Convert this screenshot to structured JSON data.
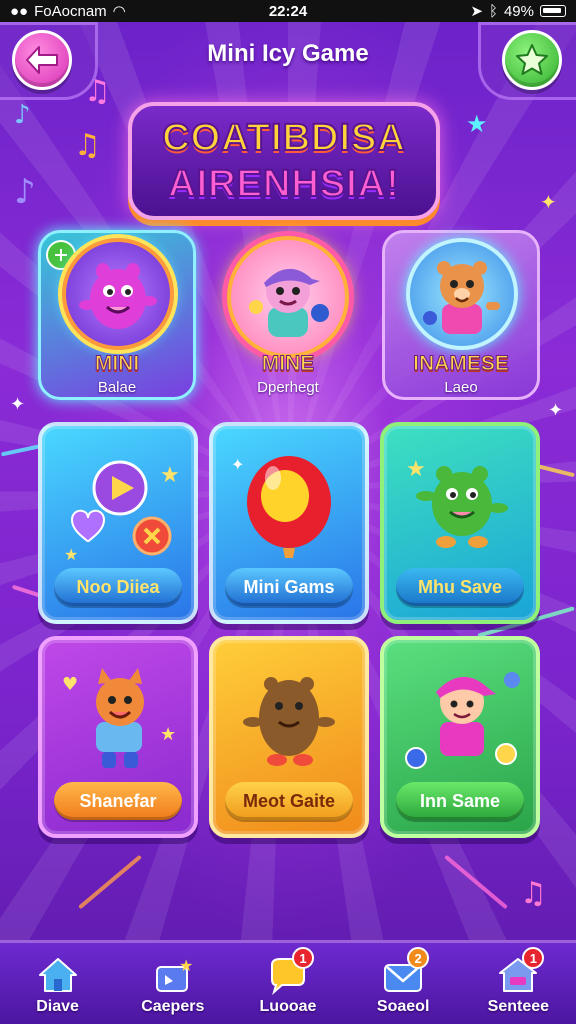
{
  "status_bar": {
    "carrier": "FoAocnam",
    "time": "22:24",
    "battery": "49%"
  },
  "header": {
    "title": "Mini Icy Game",
    "logo_line1": "COATIBDISA",
    "logo_line2": "AIRENHSIA!",
    "back_icon": "arrow-left-icon",
    "star_icon": "star-icon"
  },
  "characters": [
    {
      "name": "MINI",
      "sub": "Balae",
      "color": "#d93ee0"
    },
    {
      "name": "MINE",
      "sub": "Dperhegt",
      "color": "#f07fd0"
    },
    {
      "name": "INAMESE",
      "sub": "Laeo",
      "color": "#e99a4b"
    }
  ],
  "games": [
    {
      "label": "Noo Diiea",
      "theme": "blue"
    },
    {
      "label": "Mini Gams",
      "theme": "blue"
    },
    {
      "label": "Mhu Save",
      "theme": "green"
    },
    {
      "label": "Shanefar",
      "theme": "purple"
    },
    {
      "label": "Meot Gaite",
      "theme": "orange"
    },
    {
      "label": "Inn Same",
      "theme": "green"
    }
  ],
  "bottom_nav": [
    {
      "label": "Diave",
      "icon": "home-icon",
      "badge": ""
    },
    {
      "label": "Caepers",
      "icon": "gift-icon",
      "badge": ""
    },
    {
      "label": "Luooae",
      "icon": "chat-icon",
      "badge": "1"
    },
    {
      "label": "Soaeol",
      "icon": "mail-icon",
      "badge": "2"
    },
    {
      "label": "Senteee",
      "icon": "shop-icon",
      "badge": "1"
    }
  ],
  "colors": {
    "background": "#7a24cc",
    "accent_pink": "#ff5fd0",
    "accent_yellow": "#ffd33a",
    "nav_badge": "#e8242e"
  }
}
